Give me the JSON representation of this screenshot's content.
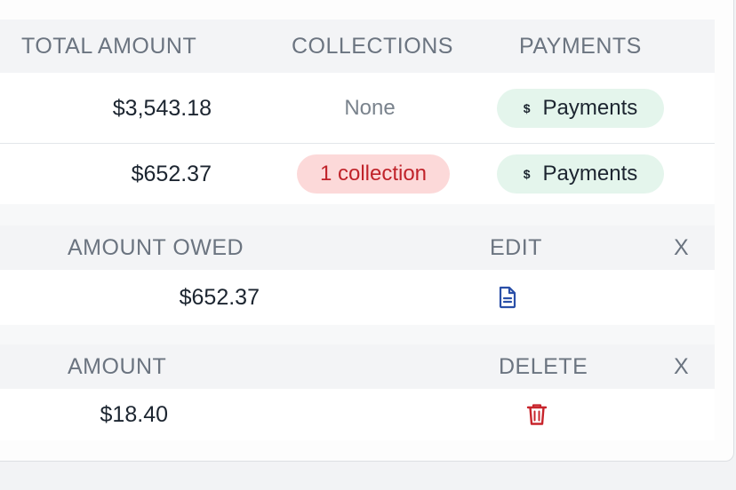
{
  "table1": {
    "headers": {
      "total_amount": "TOTAL AMOUNT",
      "collections": "COLLECTIONS",
      "payments": "PAYMENTS"
    },
    "rows": [
      {
        "total_amount": "$3,543.18",
        "collections": "None",
        "payments_label": "Payments",
        "payments_symbol": "$"
      },
      {
        "total_amount": "$652.37",
        "collections": "1 collection",
        "payments_label": "Payments",
        "payments_symbol": "$"
      }
    ]
  },
  "table2": {
    "headers": {
      "amount_owed": "AMOUNT OWED",
      "edit": "EDIT",
      "close": "X"
    },
    "rows": [
      {
        "amount_owed": "$652.37",
        "edit_icon": "document-icon"
      }
    ]
  },
  "table3": {
    "headers": {
      "amount": "AMOUNT",
      "delete": "DELETE",
      "close": "X"
    },
    "rows": [
      {
        "amount": "$18.40",
        "delete_icon": "trash-icon"
      }
    ]
  },
  "colors": {
    "header_text": "#6b7480",
    "pill_green_bg": "#e4f5ec",
    "pill_red_bg": "#fcd9d9",
    "pill_red_text": "#c0232a",
    "edit_icon": "#2a4fa8",
    "delete_icon": "#c8252c"
  }
}
